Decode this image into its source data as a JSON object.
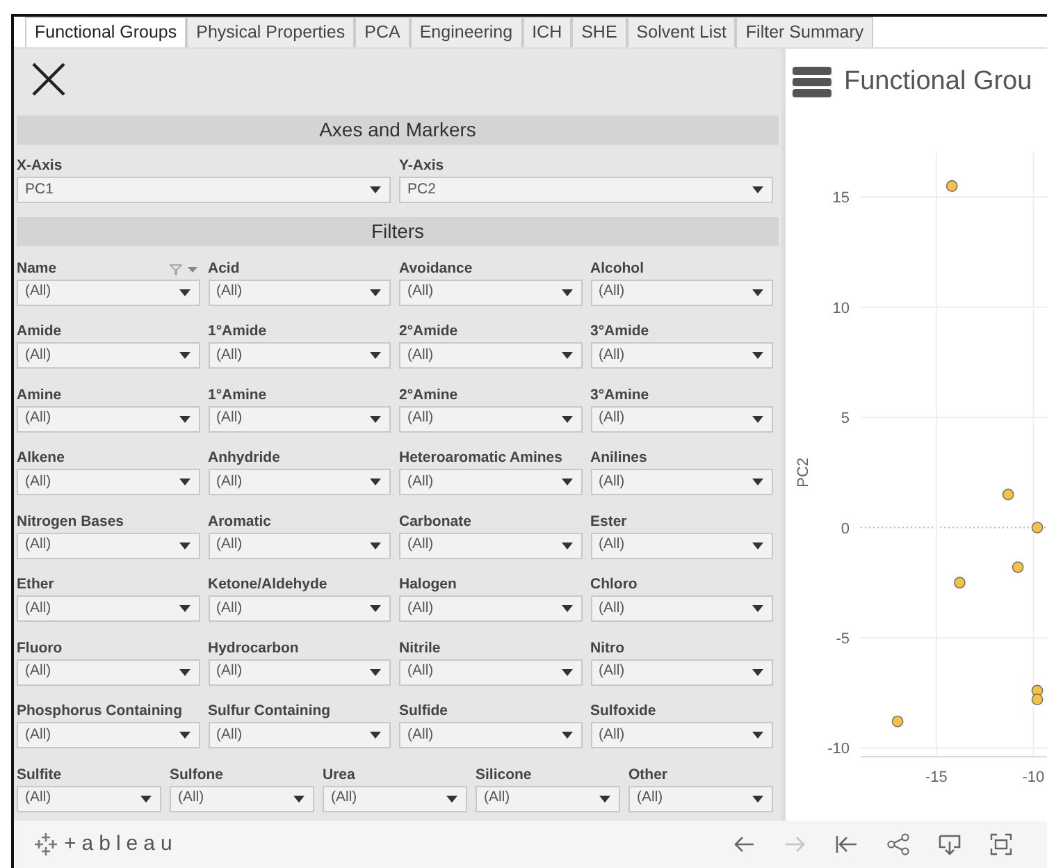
{
  "tabs": [
    {
      "label": "Functional Groups",
      "selected": true
    },
    {
      "label": "Physical Properties",
      "selected": false
    },
    {
      "label": "PCA",
      "selected": false
    },
    {
      "label": "Engineering",
      "selected": false
    },
    {
      "label": "ICH",
      "selected": false
    },
    {
      "label": "SHE",
      "selected": false
    },
    {
      "label": "Solvent List",
      "selected": false
    },
    {
      "label": "Filter Summary",
      "selected": false
    }
  ],
  "axes_section": {
    "title": "Axes and Markers",
    "controls": [
      {
        "label": "X-Axis",
        "value": "PC1"
      },
      {
        "label": "Y-Axis",
        "value": "PC2"
      }
    ]
  },
  "filters_section": {
    "title": "Filters",
    "rows": [
      [
        {
          "label": "Name",
          "value": "(All)",
          "has_menu": true
        },
        {
          "label": "Acid",
          "value": "(All)"
        },
        {
          "label": "Avoidance",
          "value": "(All)"
        },
        {
          "label": "Alcohol",
          "value": "(All)"
        }
      ],
      [
        {
          "label": "Amide",
          "value": "(All)"
        },
        {
          "label": "1°Amide",
          "value": "(All)"
        },
        {
          "label": "2°Amide",
          "value": "(All)"
        },
        {
          "label": "3°Amide",
          "value": "(All)"
        }
      ],
      [
        {
          "label": "Amine",
          "value": "(All)"
        },
        {
          "label": "1°Amine",
          "value": "(All)"
        },
        {
          "label": "2°Amine",
          "value": "(All)"
        },
        {
          "label": "3°Amine",
          "value": "(All)"
        }
      ],
      [
        {
          "label": "Alkene",
          "value": "(All)"
        },
        {
          "label": "Anhydride",
          "value": "(All)"
        },
        {
          "label": "Heteroaromatic Amines",
          "value": "(All)"
        },
        {
          "label": "Anilines",
          "value": "(All)"
        }
      ],
      [
        {
          "label": "Nitrogen Bases",
          "value": "(All)"
        },
        {
          "label": "Aromatic",
          "value": "(All)"
        },
        {
          "label": "Carbonate",
          "value": "(All)"
        },
        {
          "label": "Ester",
          "value": "(All)"
        }
      ],
      [
        {
          "label": "Ether",
          "value": "(All)"
        },
        {
          "label": "Ketone/Aldehyde",
          "value": "(All)"
        },
        {
          "label": "Halogen",
          "value": "(All)"
        },
        {
          "label": "Chloro",
          "value": "(All)"
        }
      ],
      [
        {
          "label": "Fluoro",
          "value": "(All)"
        },
        {
          "label": "Hydrocarbon",
          "value": "(All)"
        },
        {
          "label": "Nitrile",
          "value": "(All)"
        },
        {
          "label": "Nitro",
          "value": "(All)"
        }
      ],
      [
        {
          "label": "Phosphorus Containing",
          "value": "(All)"
        },
        {
          "label": "Sulfur Containing",
          "value": "(All)"
        },
        {
          "label": "Sulfide",
          "value": "(All)"
        },
        {
          "label": "Sulfoxide",
          "value": "(All)"
        }
      ],
      [
        {
          "label": "Sulfite",
          "value": "(All)"
        },
        {
          "label": "Sulfone",
          "value": "(All)"
        },
        {
          "label": "Urea",
          "value": "(All)"
        },
        {
          "label": "Silicone",
          "value": "(All)"
        },
        {
          "label": "Other",
          "value": "(All)"
        }
      ]
    ]
  },
  "chart_panel": {
    "title": "Functional Grou",
    "chart_data": {
      "type": "scatter",
      "ylabel": "PC2",
      "xlim": [
        -18.9,
        -9.3
      ],
      "ylim": [
        -10.4,
        17
      ],
      "xticks": [
        -15,
        -10
      ],
      "yticks": [
        -10,
        -5,
        0,
        5,
        10,
        15
      ],
      "grid": true,
      "ref_lines": [
        {
          "axis": "y",
          "value": 0
        }
      ],
      "series": [
        {
          "color": "#f5c242",
          "x": [
            -14.2,
            -11.3,
            -9.8,
            -10.8,
            -13.8,
            -9.8,
            -9.8,
            -17
          ],
          "values": [
            15.5,
            1.5,
            0,
            -1.8,
            -2.5,
            -7.4,
            -7.8,
            -8.8
          ]
        }
      ]
    }
  },
  "footer": {
    "logo": "+ableau",
    "toolbar": [
      {
        "kind": "back",
        "disabled": false
      },
      {
        "kind": "forward",
        "disabled": true
      },
      {
        "kind": "first",
        "disabled": false
      },
      {
        "kind": "share",
        "disabled": false
      },
      {
        "kind": "download",
        "disabled": false
      },
      {
        "kind": "fullscreen",
        "disabled": false
      }
    ]
  }
}
